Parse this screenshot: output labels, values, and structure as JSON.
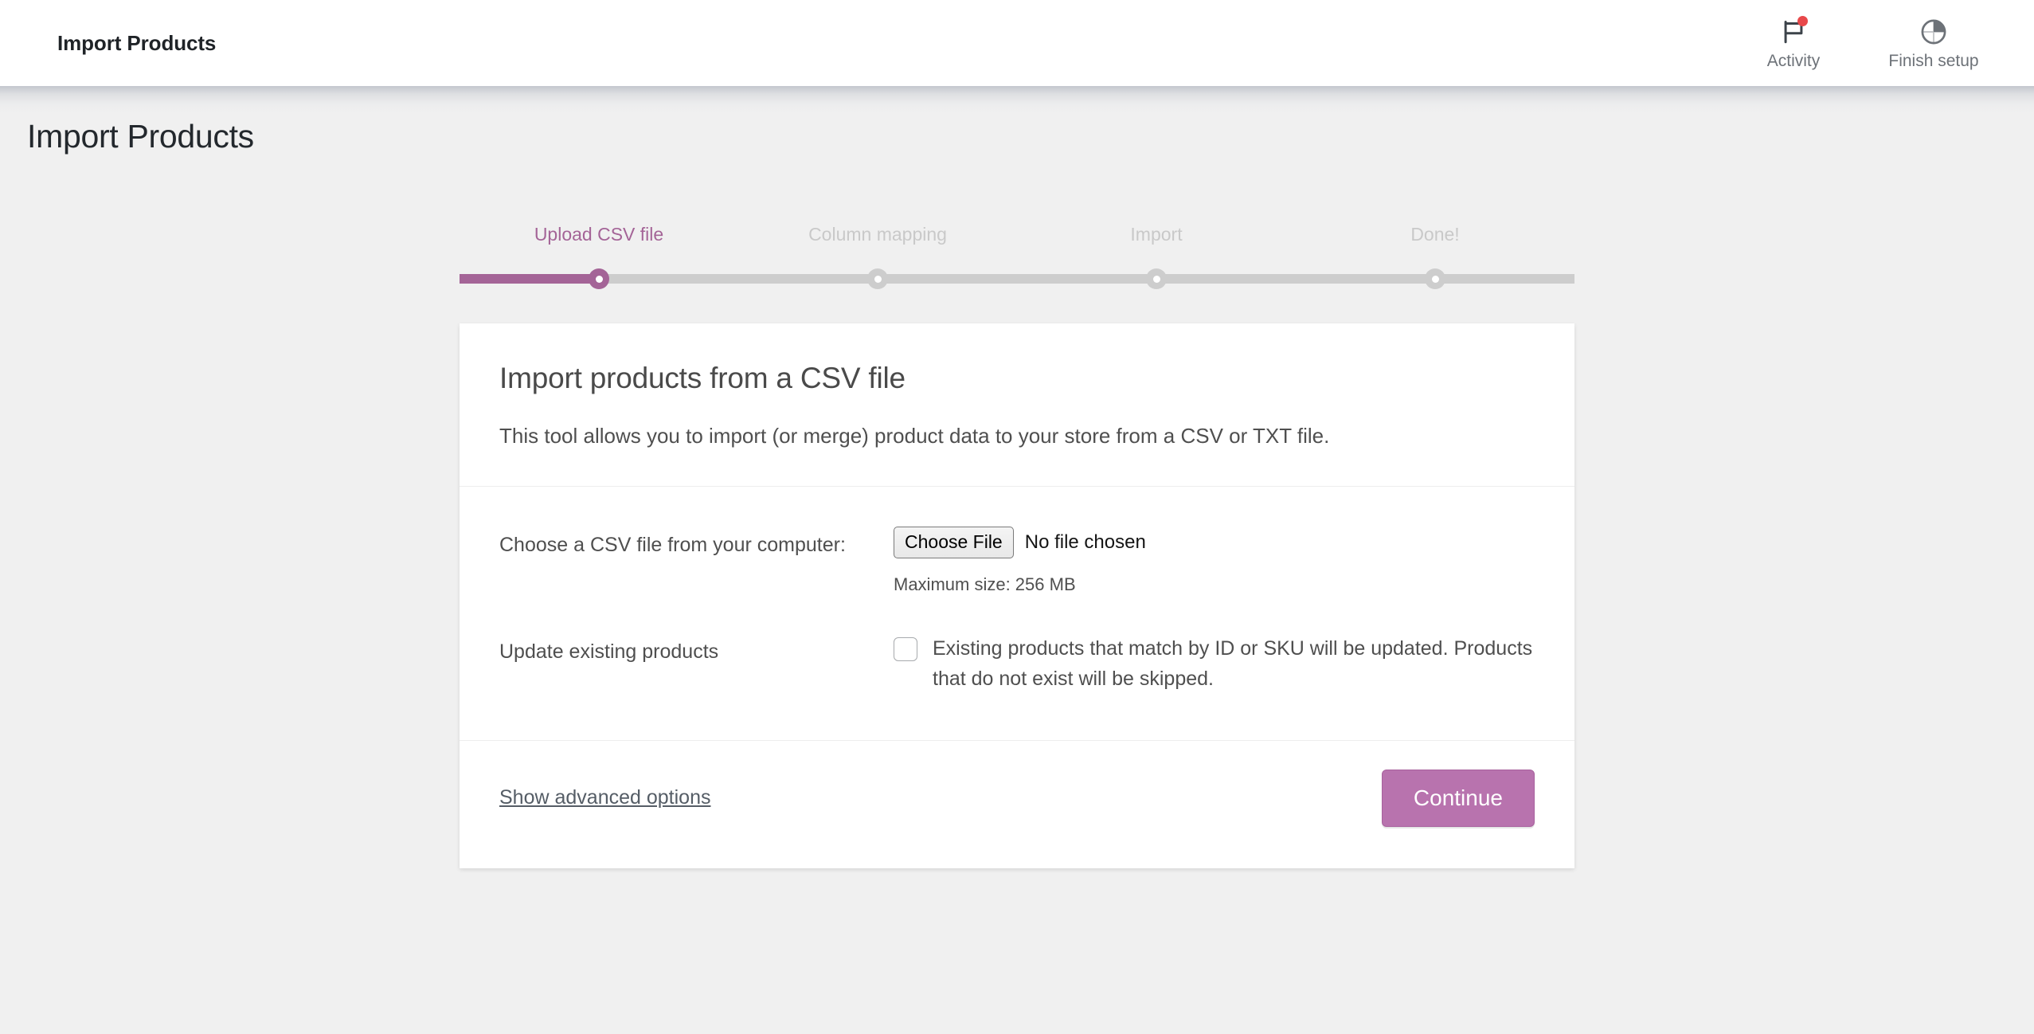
{
  "adminbar": {
    "title": "Import Products",
    "items": [
      {
        "label": "Activity",
        "icon": "flag-icon",
        "badge": true
      },
      {
        "label": "Finish setup",
        "icon": "pie-progress-icon",
        "badge": false
      }
    ]
  },
  "page": {
    "title": "Import Products"
  },
  "stepper": {
    "steps": [
      {
        "label": "Upload CSV file",
        "state": "active"
      },
      {
        "label": "Column mapping",
        "state": "inactive"
      },
      {
        "label": "Import",
        "state": "inactive"
      },
      {
        "label": "Done!",
        "state": "inactive"
      }
    ],
    "active_index": 0,
    "accent_color": "#a46497",
    "track_color": "#cdcdcd"
  },
  "card": {
    "title": "Import products from a CSV file",
    "description": "This tool allows you to import (or merge) product data to your store from a CSV or TXT file.",
    "file_row": {
      "label": "Choose a CSV file from your computer:",
      "button_label": "Choose File",
      "file_status": "No file chosen",
      "hint": "Maximum size: 256 MB"
    },
    "update_row": {
      "label": "Update existing products",
      "checkbox_checked": false,
      "description": "Existing products that match by ID or SKU will be updated. Products that do not exist will be skipped."
    },
    "footer": {
      "advanced_link": "Show advanced options",
      "continue_label": "Continue",
      "continue_color": "#b873ae"
    }
  }
}
